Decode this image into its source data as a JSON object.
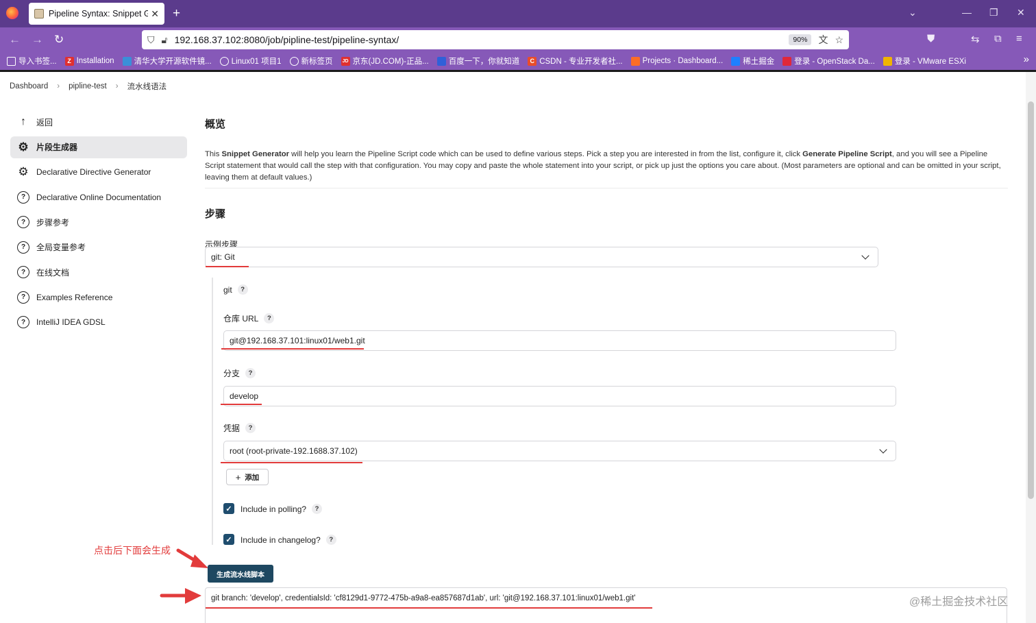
{
  "browser": {
    "tab_title": "Pipeline Syntax: Snippet Gene",
    "url": "192.168.37.102:8080/job/pipline-test/pipeline-syntax/",
    "zoom": "90%",
    "bookmarks": [
      {
        "label": "导入书签...",
        "color": "#ffffff",
        "icon": "import-icon"
      },
      {
        "label": "Installation",
        "color": "#e03030",
        "icon": "Z"
      },
      {
        "label": "清华大学开源软件镜...",
        "color": "#3a8fd8",
        "icon": "bird-icon"
      },
      {
        "label": "Linux01 项目1",
        "color": "#ffffff",
        "icon": "globe-icon"
      },
      {
        "label": "新标签页",
        "color": "#ffffff",
        "icon": "globe-icon"
      },
      {
        "label": "京东(JD.COM)-正品...",
        "color": "#e03030",
        "icon": "JD"
      },
      {
        "label": "百度一下，你就知道",
        "color": "#3060d8",
        "icon": "paw-icon"
      },
      {
        "label": "CSDN - 专业开发者社...",
        "color": "#e84d2b",
        "icon": "C"
      },
      {
        "label": "Projects · Dashboard...",
        "color": "#fc6d26",
        "icon": "gitlab-icon"
      },
      {
        "label": "稀土掘金",
        "color": "#1e80ff",
        "icon": "juejin-icon"
      },
      {
        "label": "登录 - OpenStack Da...",
        "color": "#e0283a",
        "icon": "openstack-icon"
      },
      {
        "label": "登录 - VMware ESXi",
        "color": "#f0b400",
        "icon": "vmware-icon"
      }
    ]
  },
  "breadcrumb": [
    "Dashboard",
    "pipline-test",
    "流水线语法"
  ],
  "sidebar": {
    "items": [
      {
        "label": "返回",
        "icon": "arrow-up-icon",
        "active": false
      },
      {
        "label": "片段生成器",
        "icon": "gear-icon",
        "active": true
      },
      {
        "label": "Declarative Directive Generator",
        "icon": "gear-icon",
        "active": false
      },
      {
        "label": "Declarative Online Documentation",
        "icon": "help-circle-icon",
        "active": false
      },
      {
        "label": "步骤参考",
        "icon": "help-circle-icon",
        "active": false
      },
      {
        "label": "全局变量参考",
        "icon": "help-circle-icon",
        "active": false
      },
      {
        "label": "在线文档",
        "icon": "help-circle-icon",
        "active": false
      },
      {
        "label": "Examples Reference",
        "icon": "help-circle-icon",
        "active": false
      },
      {
        "label": "IntelliJ IDEA GDSL",
        "icon": "help-circle-icon",
        "active": false
      }
    ]
  },
  "main": {
    "overview_title": "概览",
    "description": {
      "p1": "This ",
      "b1": "Snippet Generator",
      "p2": " will help you learn the Pipeline Script code which can be used to define various steps. Pick a step you are interested in from the list, configure it, click ",
      "b2": "Generate Pipeline Script",
      "p3": ", and you will see a Pipeline Script statement that would call the step with that configuration. You may copy and paste the whole statement into your script, or pick up just the options you care about. (Most parameters are optional and can be omitted in your script, leaving them at default values.)"
    },
    "steps_title": "步骤",
    "sample_step_label": "示例步骤",
    "sample_step_value": "git: Git",
    "git_label": "git",
    "repo_url_label": "仓库 URL",
    "repo_url_value": "git@192.168.37.101:linux01/web1.git",
    "branch_label": "分支",
    "branch_value": "develop",
    "credentials_label": "凭据",
    "credentials_value": "root (root-private-192.1688.37.102)",
    "add_button": "添加",
    "polling_label": "Include in polling?",
    "polling_checked": true,
    "changelog_label": "Include in changelog?",
    "changelog_checked": true,
    "generate_button": "生成流水线脚本",
    "output": "git branch: 'develop', credentialsId: 'cf8129d1-9772-475b-a9a8-ea857687d1ab', url: 'git@192.168.37.101:linux01/web1.git'"
  },
  "annotation": "点击后下面会生成",
  "watermark": "@稀土掘金技术社区",
  "colors": {
    "tabbar": "#5b3b8c",
    "toolbar": "#8659b8",
    "primary_button": "#1e4861",
    "annotation_red": "#e23b3b"
  }
}
